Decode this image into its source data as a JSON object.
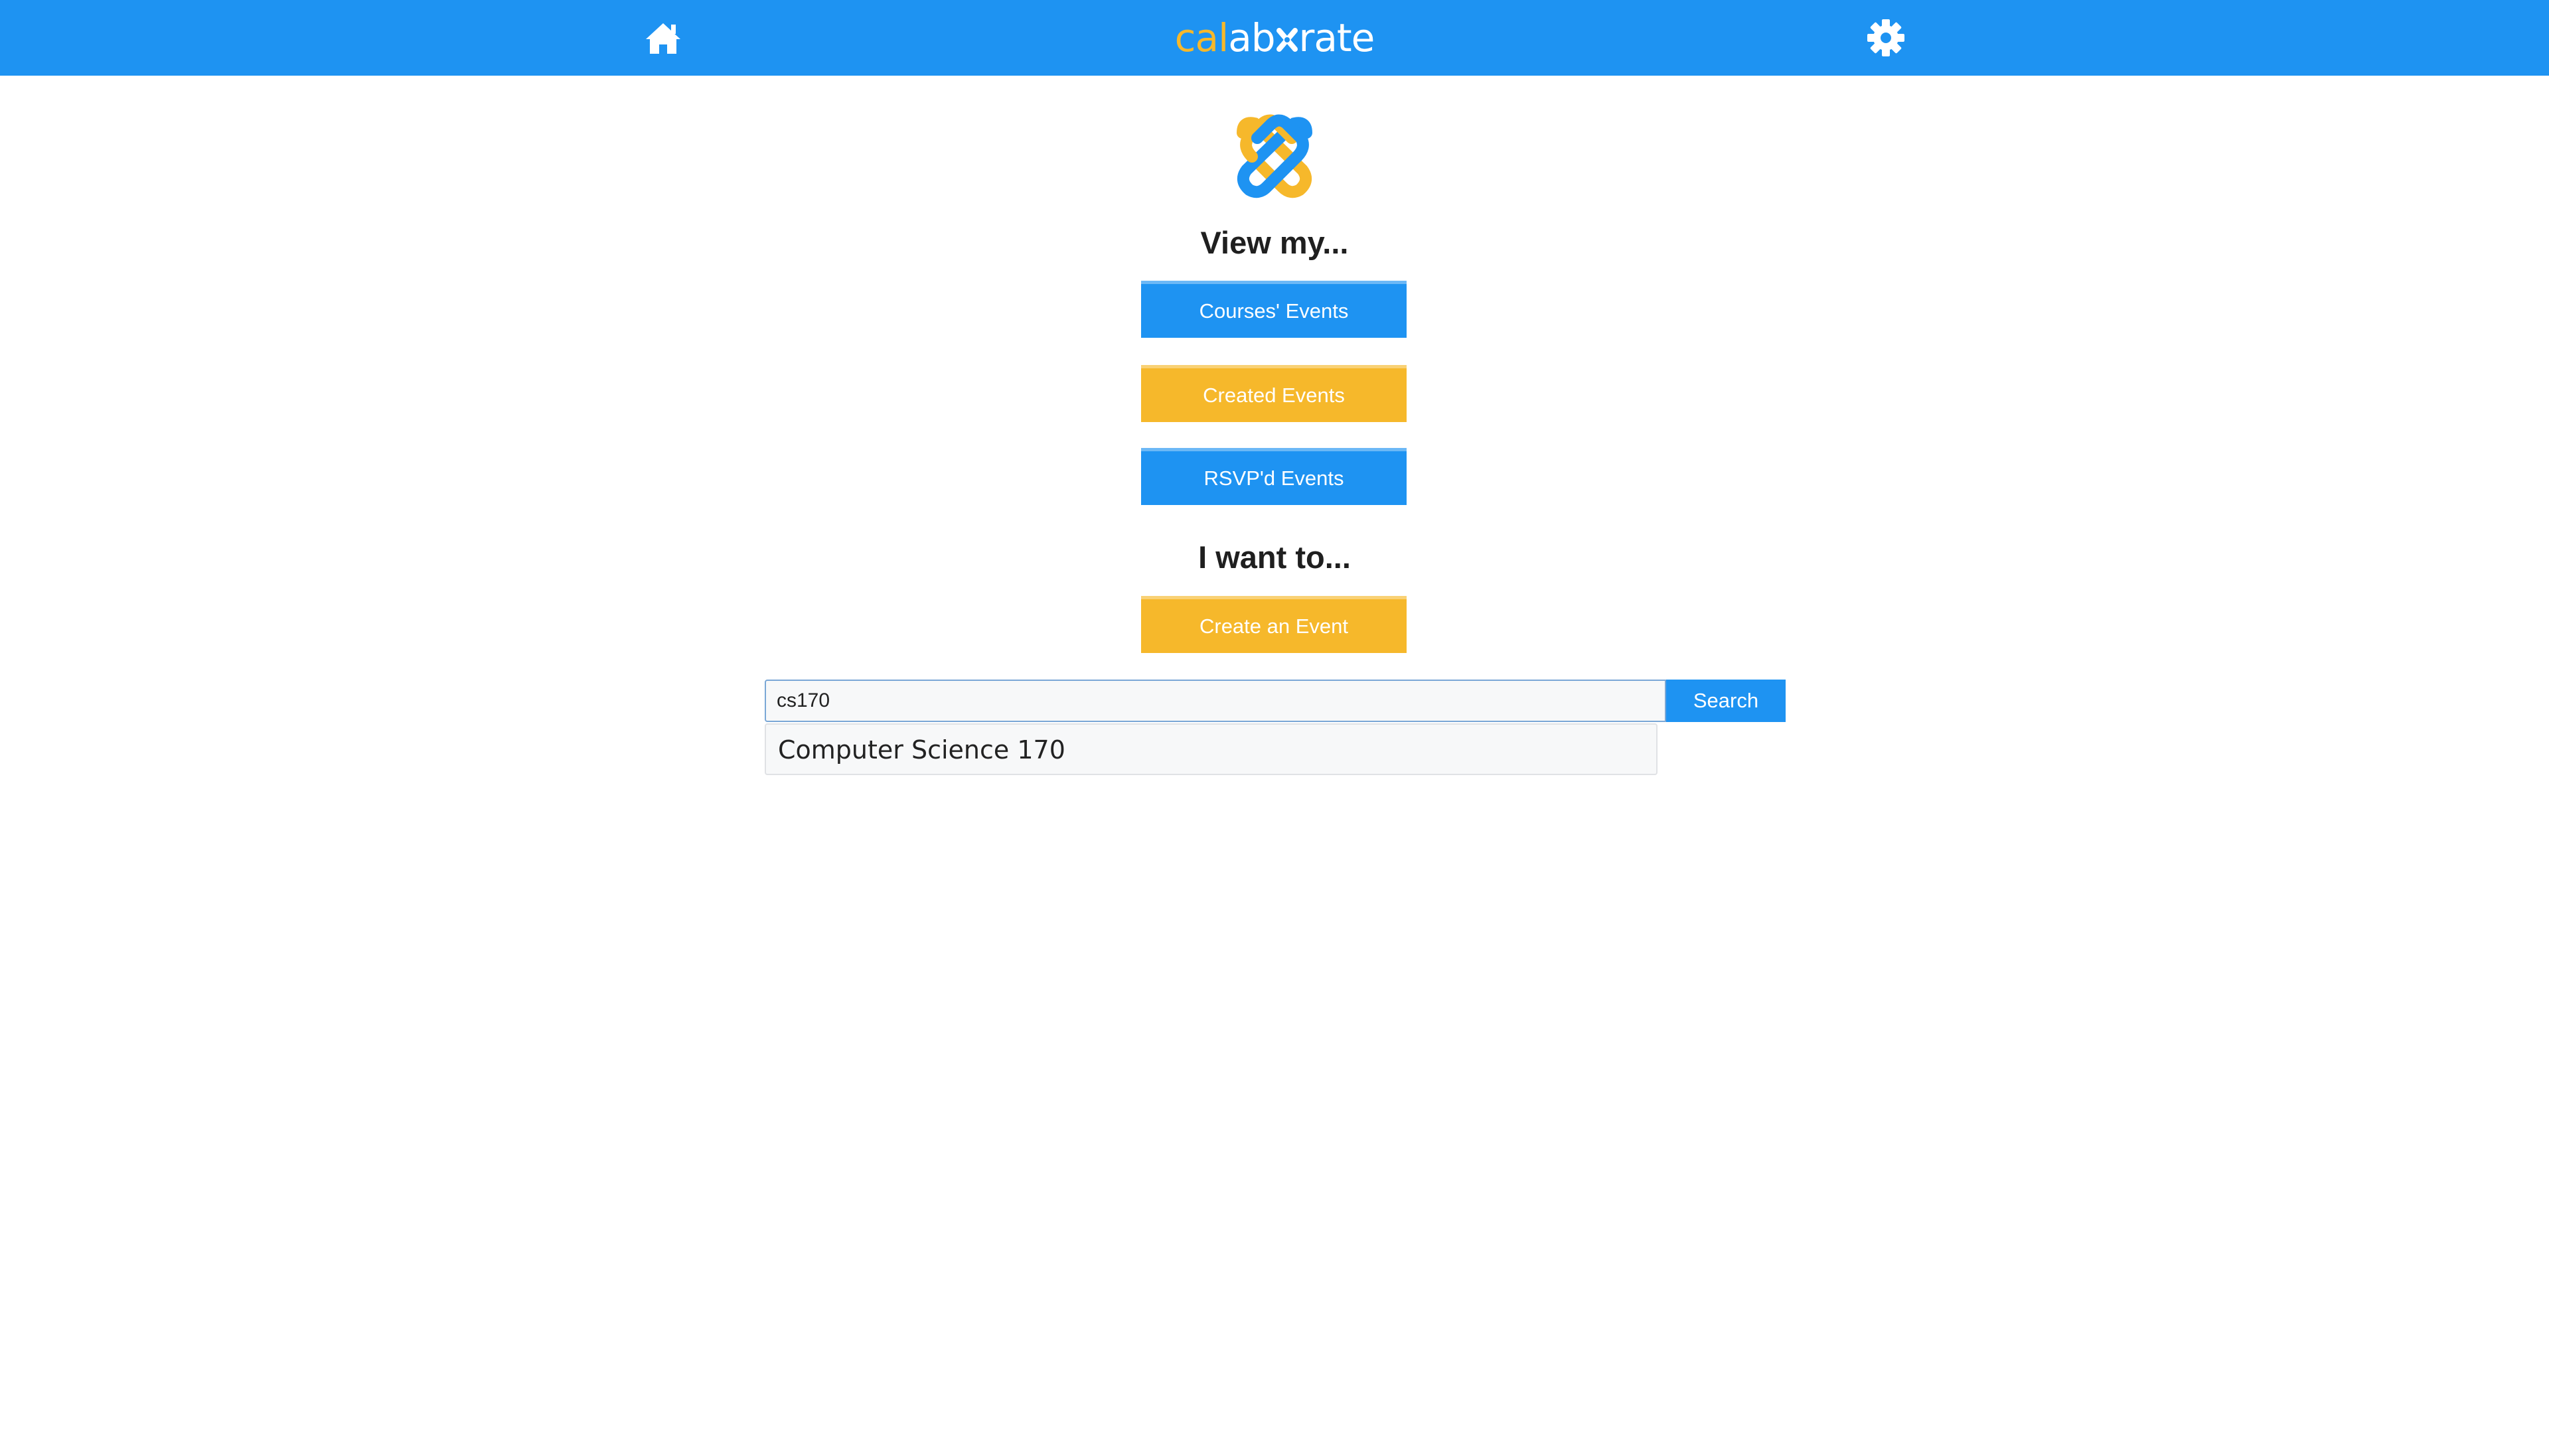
{
  "nav": {
    "home_icon": "home-icon",
    "settings_icon": "gear-icon",
    "brand": {
      "part1": "cal",
      "part2": "ab",
      "part3": "rate",
      "mark_icon": "link-knot-icon"
    }
  },
  "main": {
    "logo_icon": "calaborate-knot-logo",
    "view_heading": "View my...",
    "view_buttons": [
      {
        "label": "Courses' Events",
        "color": "#1e93f2"
      },
      {
        "label": "Created Events",
        "color": "#f6b82b"
      },
      {
        "label": "RSVP'd Events",
        "color": "#1e93f2"
      }
    ],
    "want_heading": "I want to...",
    "create_button": {
      "label": "Create an Event",
      "color": "#f6b82b"
    }
  },
  "search": {
    "value": "cs170",
    "button_label": "Search",
    "suggestions": [
      {
        "label": "Computer Science 170"
      }
    ]
  },
  "colors": {
    "primary": "#1e93f2",
    "accent": "#f6b82b"
  }
}
